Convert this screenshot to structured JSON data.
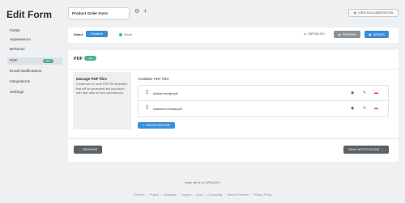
{
  "header": {
    "title": "Edit Form",
    "form_name": "Product Order Form",
    "view_docs_label": "VIEW DOCUMENTATION"
  },
  "sidebar": {
    "items": [
      {
        "label": "Fields"
      },
      {
        "label": "Appearance"
      },
      {
        "label": "Behavior"
      },
      {
        "label": "PDF",
        "badge": "New",
        "active": true
      },
      {
        "label": "Email Notifications"
      },
      {
        "label": "Integrations"
      },
      {
        "label": "Settings"
      }
    ]
  },
  "status_bar": {
    "status_label": "Status",
    "status_value": "Published",
    "saved_label": "Saved",
    "unpublish_label": "UNPUBLISH",
    "preview_label": "PREVIEW",
    "update_label": "UPDATE"
  },
  "panel": {
    "heading": "PDF",
    "badge": "New",
    "manage_title": "Manage PDF files",
    "manage_desc": "Create one or more PDF file templates that will be generated and populated with user data on form submissions.",
    "available_title": "Available PDF files",
    "files": [
      {
        "name": "Admin-receipt.pdf"
      },
      {
        "name": "customer-receipt.pdf"
      }
    ],
    "create_label": "CREATE NEW PDF",
    "back_label": "BEHAVIOR",
    "next_label": "EMAIL NOTIFICATIONS"
  },
  "footer": {
    "made_with": "Made with ♥ by WPMUDEV",
    "links": [
      "The Hub",
      "Plugins",
      "Roadmap",
      "Support",
      "Docs",
      "Community",
      "Terms of Service",
      "Privacy Policy"
    ]
  },
  "colors": {
    "accent": "#3b8fd8",
    "badge_green": "#4caf92",
    "dark_button": "#5b6168",
    "danger": "#d9534f"
  }
}
